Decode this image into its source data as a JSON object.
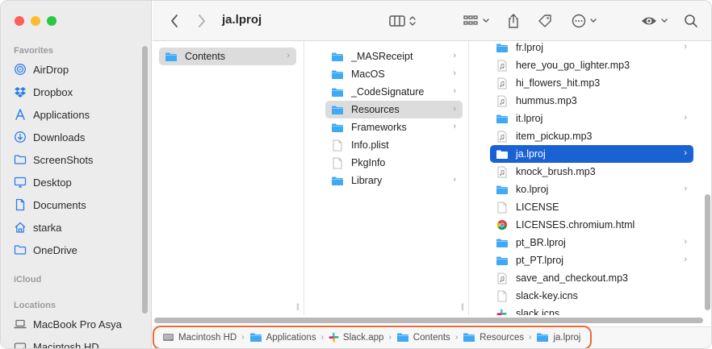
{
  "window": {
    "title": "ja.lproj"
  },
  "colors": {
    "accent": "#1a62d4",
    "folder": "#3fa9f5",
    "highlight_ring": "#ea6b34"
  },
  "sidebar": {
    "sections": [
      {
        "label": "Favorites",
        "items": [
          {
            "label": "AirDrop",
            "icon": "airdrop-icon"
          },
          {
            "label": "Dropbox",
            "icon": "dropbox-icon"
          },
          {
            "label": "Applications",
            "icon": "applications-icon"
          },
          {
            "label": "Downloads",
            "icon": "downloads-icon"
          },
          {
            "label": "ScreenShots",
            "icon": "folder-icon"
          },
          {
            "label": "Desktop",
            "icon": "desktop-icon"
          },
          {
            "label": "Documents",
            "icon": "document-icon"
          },
          {
            "label": "starka",
            "icon": "home-icon"
          },
          {
            "label": "OneDrive",
            "icon": "folder-icon"
          }
        ]
      },
      {
        "label": "iCloud",
        "items": []
      },
      {
        "label": "Locations",
        "items": [
          {
            "label": "MacBook Pro Asya",
            "icon": "laptop-icon"
          },
          {
            "label": "Macintosh HD",
            "icon": "disk-icon"
          }
        ]
      }
    ]
  },
  "columns": [
    [
      {
        "label": "Contents",
        "kind": "folder",
        "chevron": true,
        "selected": "grey"
      }
    ],
    [
      {
        "label": "_MASReceipt",
        "kind": "folder",
        "chevron": true
      },
      {
        "label": "MacOS",
        "kind": "folder",
        "chevron": true
      },
      {
        "label": "_CodeSignature",
        "kind": "folder",
        "chevron": true
      },
      {
        "label": "Resources",
        "kind": "folder",
        "chevron": true,
        "selected": "grey"
      },
      {
        "label": "Frameworks",
        "kind": "folder",
        "chevron": true
      },
      {
        "label": "Info.plist",
        "kind": "file"
      },
      {
        "label": "PkgInfo",
        "kind": "file"
      },
      {
        "label": "Library",
        "kind": "folder",
        "chevron": true
      }
    ],
    [
      {
        "label": "fr.lproj",
        "kind": "folder",
        "chevron": true
      },
      {
        "label": "here_you_go_lighter.mp3",
        "kind": "audio"
      },
      {
        "label": "hi_flowers_hit.mp3",
        "kind": "audio"
      },
      {
        "label": "hummus.mp3",
        "kind": "audio"
      },
      {
        "label": "it.lproj",
        "kind": "folder",
        "chevron": true
      },
      {
        "label": "item_pickup.mp3",
        "kind": "audio"
      },
      {
        "label": "ja.lproj",
        "kind": "folder",
        "chevron": true,
        "selected": "blue"
      },
      {
        "label": "knock_brush.mp3",
        "kind": "audio"
      },
      {
        "label": "ko.lproj",
        "kind": "folder",
        "chevron": true
      },
      {
        "label": "LICENSE",
        "kind": "file"
      },
      {
        "label": "LICENSES.chromium.html",
        "kind": "chrome"
      },
      {
        "label": "pt_BR.lproj",
        "kind": "folder",
        "chevron": true
      },
      {
        "label": "pt_PT.lproj",
        "kind": "folder",
        "chevron": true
      },
      {
        "label": "save_and_checkout.mp3",
        "kind": "audio"
      },
      {
        "label": "slack-key.icns",
        "kind": "file"
      },
      {
        "label": "slack.icns",
        "kind": "slack"
      }
    ]
  ],
  "pathbar": [
    {
      "label": "Macintosh HD",
      "icon": "disk-icon"
    },
    {
      "label": "Applications",
      "icon": "folder-icon"
    },
    {
      "label": "Slack.app",
      "icon": "slack-icon"
    },
    {
      "label": "Contents",
      "icon": "folder-icon"
    },
    {
      "label": "Resources",
      "icon": "folder-icon"
    },
    {
      "label": "ja.lproj",
      "icon": "folder-icon"
    }
  ]
}
